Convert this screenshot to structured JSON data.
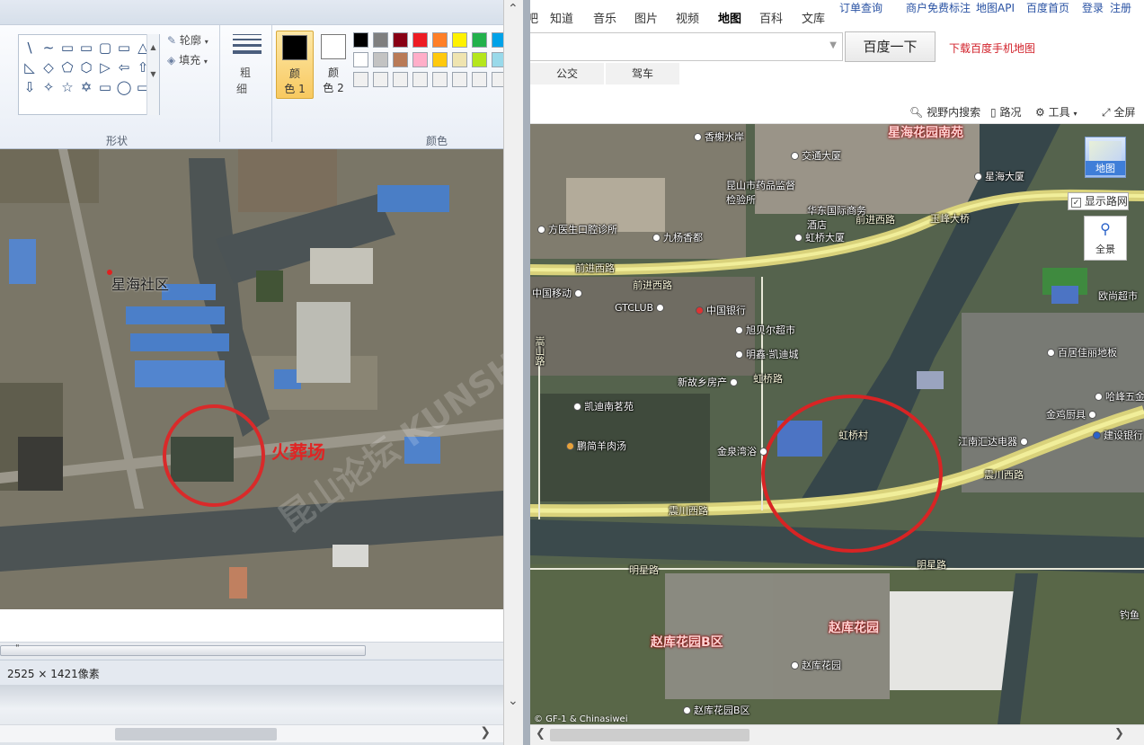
{
  "paint": {
    "ribbon": {
      "outline_label": "轮廓",
      "fill_label": "填充",
      "shapes_group_label": "形状",
      "size_label_1": "粗",
      "size_label_2": "细",
      "color1_label_1": "颜",
      "color1_label_2": "色 1",
      "color2_label_1": "颜",
      "color2_label_2": "色 2",
      "colors_group_label": "颜色",
      "color1_value": "#000000",
      "color2_value": "#ffffff",
      "shape_icons": [
        "\\",
        "∼",
        "▭",
        "▭",
        "▢",
        "▭",
        "△",
        "◺",
        "◇",
        "⬠",
        "⬡",
        "▷",
        "⇦",
        "⇧",
        "⇩",
        "✧",
        "☆",
        "✡",
        "▭",
        "◯",
        "▭"
      ],
      "palette_row1": [
        "#000000",
        "#7f7f7f",
        "#880015",
        "#ed1c24",
        "#ff7f27",
        "#fff200",
        "#22b14c",
        "#00a2e8"
      ],
      "palette_row2": [
        "#ffffff",
        "#c3c3c3",
        "#b97a57",
        "#ffaec9",
        "#ffc90e",
        "#efe4b0",
        "#b5e61d",
        "#99d9ea"
      ],
      "palette_row3": [
        "#f0f0f0",
        "#f0f0f0",
        "#f0f0f0",
        "#f0f0f0",
        "#f0f0f0",
        "#f0f0f0",
        "#f0f0f0",
        "#f0f0f0"
      ]
    },
    "map_labels": {
      "community": "星海社区",
      "crematorium": "火葬场"
    },
    "scroll_marker": "\"",
    "status_size": "2525 × 1421像素",
    "watermark": "昆山论坛 KUNSHAN BBS"
  },
  "baidu": {
    "nav": [
      "知道",
      "音乐",
      "图片",
      "视频",
      "地图",
      "百科",
      "文库"
    ],
    "nav_prefix": "吧",
    "nav_active": "地图",
    "top_links": [
      "订单查询",
      "商户免费标注",
      "地图API",
      "百度首页",
      "登录",
      "注册"
    ],
    "search_placeholder": "",
    "search_button": "百度一下",
    "download_link": "下载百度手机地图",
    "route_tabs": [
      "公交",
      "驾车"
    ],
    "tools": [
      "视野内搜索",
      "路况",
      "工具",
      "全屏"
    ],
    "map_type": "地图",
    "show_roads": "显示路网",
    "panorama": "全景",
    "copyright": "© GF-1 & Chinasiwei",
    "districts": [
      "星海花园南苑",
      "赵库花园B区",
      "赵库花园"
    ],
    "roads": [
      "前进西路",
      "前进西路",
      "玉峰大桥",
      "震川西路",
      "震川西路",
      "明星路",
      "明星路",
      "虹桥路",
      "嵩山路"
    ],
    "pois": [
      "香榭水岸",
      "交通大厦",
      "星海大厦",
      "昆山市药品监督检验所",
      "华东国际商务酒店",
      "虹桥大厦",
      "方医生口腔诊所",
      "九杨香都",
      "中国移动",
      "GTCLUB",
      "中国银行",
      "旭贝尔超市",
      "明鑫·凯迪城",
      "新故乡房产",
      "凯迪南茗苑",
      "鹏简羊肉汤",
      "金泉湾浴",
      "虹桥村",
      "百居佳丽地板",
      "欧尚超市",
      "哈峰五金",
      "金鸡厨具",
      "江南汇达电器",
      "建设银行",
      "赵库花园",
      "赵库花园B区",
      "钓鱼",
      "嵩山路"
    ]
  }
}
